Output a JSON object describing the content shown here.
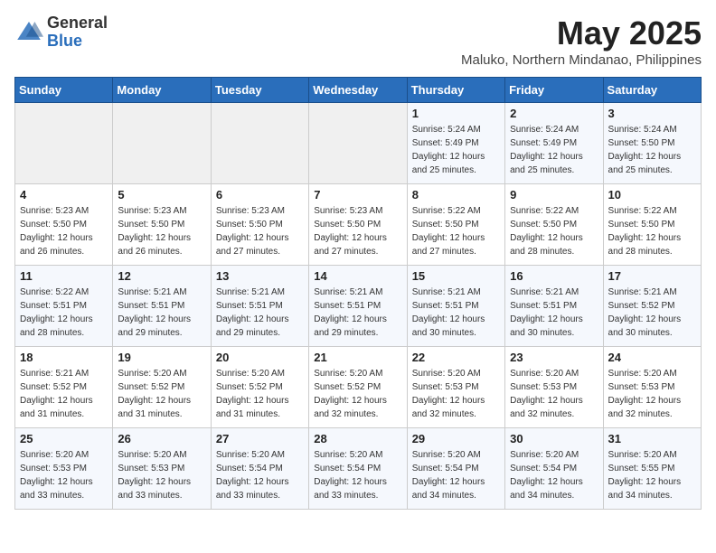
{
  "logo": {
    "text_general": "General",
    "text_blue": "Blue"
  },
  "title": {
    "month_year": "May 2025",
    "location": "Maluko, Northern Mindanao, Philippines"
  },
  "weekdays": [
    "Sunday",
    "Monday",
    "Tuesday",
    "Wednesday",
    "Thursday",
    "Friday",
    "Saturday"
  ],
  "weeks": [
    [
      {
        "day": "",
        "info": ""
      },
      {
        "day": "",
        "info": ""
      },
      {
        "day": "",
        "info": ""
      },
      {
        "day": "",
        "info": ""
      },
      {
        "day": "1",
        "info": "Sunrise: 5:24 AM\nSunset: 5:49 PM\nDaylight: 12 hours\nand 25 minutes."
      },
      {
        "day": "2",
        "info": "Sunrise: 5:24 AM\nSunset: 5:49 PM\nDaylight: 12 hours\nand 25 minutes."
      },
      {
        "day": "3",
        "info": "Sunrise: 5:24 AM\nSunset: 5:50 PM\nDaylight: 12 hours\nand 25 minutes."
      }
    ],
    [
      {
        "day": "4",
        "info": "Sunrise: 5:23 AM\nSunset: 5:50 PM\nDaylight: 12 hours\nand 26 minutes."
      },
      {
        "day": "5",
        "info": "Sunrise: 5:23 AM\nSunset: 5:50 PM\nDaylight: 12 hours\nand 26 minutes."
      },
      {
        "day": "6",
        "info": "Sunrise: 5:23 AM\nSunset: 5:50 PM\nDaylight: 12 hours\nand 27 minutes."
      },
      {
        "day": "7",
        "info": "Sunrise: 5:23 AM\nSunset: 5:50 PM\nDaylight: 12 hours\nand 27 minutes."
      },
      {
        "day": "8",
        "info": "Sunrise: 5:22 AM\nSunset: 5:50 PM\nDaylight: 12 hours\nand 27 minutes."
      },
      {
        "day": "9",
        "info": "Sunrise: 5:22 AM\nSunset: 5:50 PM\nDaylight: 12 hours\nand 28 minutes."
      },
      {
        "day": "10",
        "info": "Sunrise: 5:22 AM\nSunset: 5:50 PM\nDaylight: 12 hours\nand 28 minutes."
      }
    ],
    [
      {
        "day": "11",
        "info": "Sunrise: 5:22 AM\nSunset: 5:51 PM\nDaylight: 12 hours\nand 28 minutes."
      },
      {
        "day": "12",
        "info": "Sunrise: 5:21 AM\nSunset: 5:51 PM\nDaylight: 12 hours\nand 29 minutes."
      },
      {
        "day": "13",
        "info": "Sunrise: 5:21 AM\nSunset: 5:51 PM\nDaylight: 12 hours\nand 29 minutes."
      },
      {
        "day": "14",
        "info": "Sunrise: 5:21 AM\nSunset: 5:51 PM\nDaylight: 12 hours\nand 29 minutes."
      },
      {
        "day": "15",
        "info": "Sunrise: 5:21 AM\nSunset: 5:51 PM\nDaylight: 12 hours\nand 30 minutes."
      },
      {
        "day": "16",
        "info": "Sunrise: 5:21 AM\nSunset: 5:51 PM\nDaylight: 12 hours\nand 30 minutes."
      },
      {
        "day": "17",
        "info": "Sunrise: 5:21 AM\nSunset: 5:52 PM\nDaylight: 12 hours\nand 30 minutes."
      }
    ],
    [
      {
        "day": "18",
        "info": "Sunrise: 5:21 AM\nSunset: 5:52 PM\nDaylight: 12 hours\nand 31 minutes."
      },
      {
        "day": "19",
        "info": "Sunrise: 5:20 AM\nSunset: 5:52 PM\nDaylight: 12 hours\nand 31 minutes."
      },
      {
        "day": "20",
        "info": "Sunrise: 5:20 AM\nSunset: 5:52 PM\nDaylight: 12 hours\nand 31 minutes."
      },
      {
        "day": "21",
        "info": "Sunrise: 5:20 AM\nSunset: 5:52 PM\nDaylight: 12 hours\nand 32 minutes."
      },
      {
        "day": "22",
        "info": "Sunrise: 5:20 AM\nSunset: 5:53 PM\nDaylight: 12 hours\nand 32 minutes."
      },
      {
        "day": "23",
        "info": "Sunrise: 5:20 AM\nSunset: 5:53 PM\nDaylight: 12 hours\nand 32 minutes."
      },
      {
        "day": "24",
        "info": "Sunrise: 5:20 AM\nSunset: 5:53 PM\nDaylight: 12 hours\nand 32 minutes."
      }
    ],
    [
      {
        "day": "25",
        "info": "Sunrise: 5:20 AM\nSunset: 5:53 PM\nDaylight: 12 hours\nand 33 minutes."
      },
      {
        "day": "26",
        "info": "Sunrise: 5:20 AM\nSunset: 5:53 PM\nDaylight: 12 hours\nand 33 minutes."
      },
      {
        "day": "27",
        "info": "Sunrise: 5:20 AM\nSunset: 5:54 PM\nDaylight: 12 hours\nand 33 minutes."
      },
      {
        "day": "28",
        "info": "Sunrise: 5:20 AM\nSunset: 5:54 PM\nDaylight: 12 hours\nand 33 minutes."
      },
      {
        "day": "29",
        "info": "Sunrise: 5:20 AM\nSunset: 5:54 PM\nDaylight: 12 hours\nand 34 minutes."
      },
      {
        "day": "30",
        "info": "Sunrise: 5:20 AM\nSunset: 5:54 PM\nDaylight: 12 hours\nand 34 minutes."
      },
      {
        "day": "31",
        "info": "Sunrise: 5:20 AM\nSunset: 5:55 PM\nDaylight: 12 hours\nand 34 minutes."
      }
    ]
  ]
}
